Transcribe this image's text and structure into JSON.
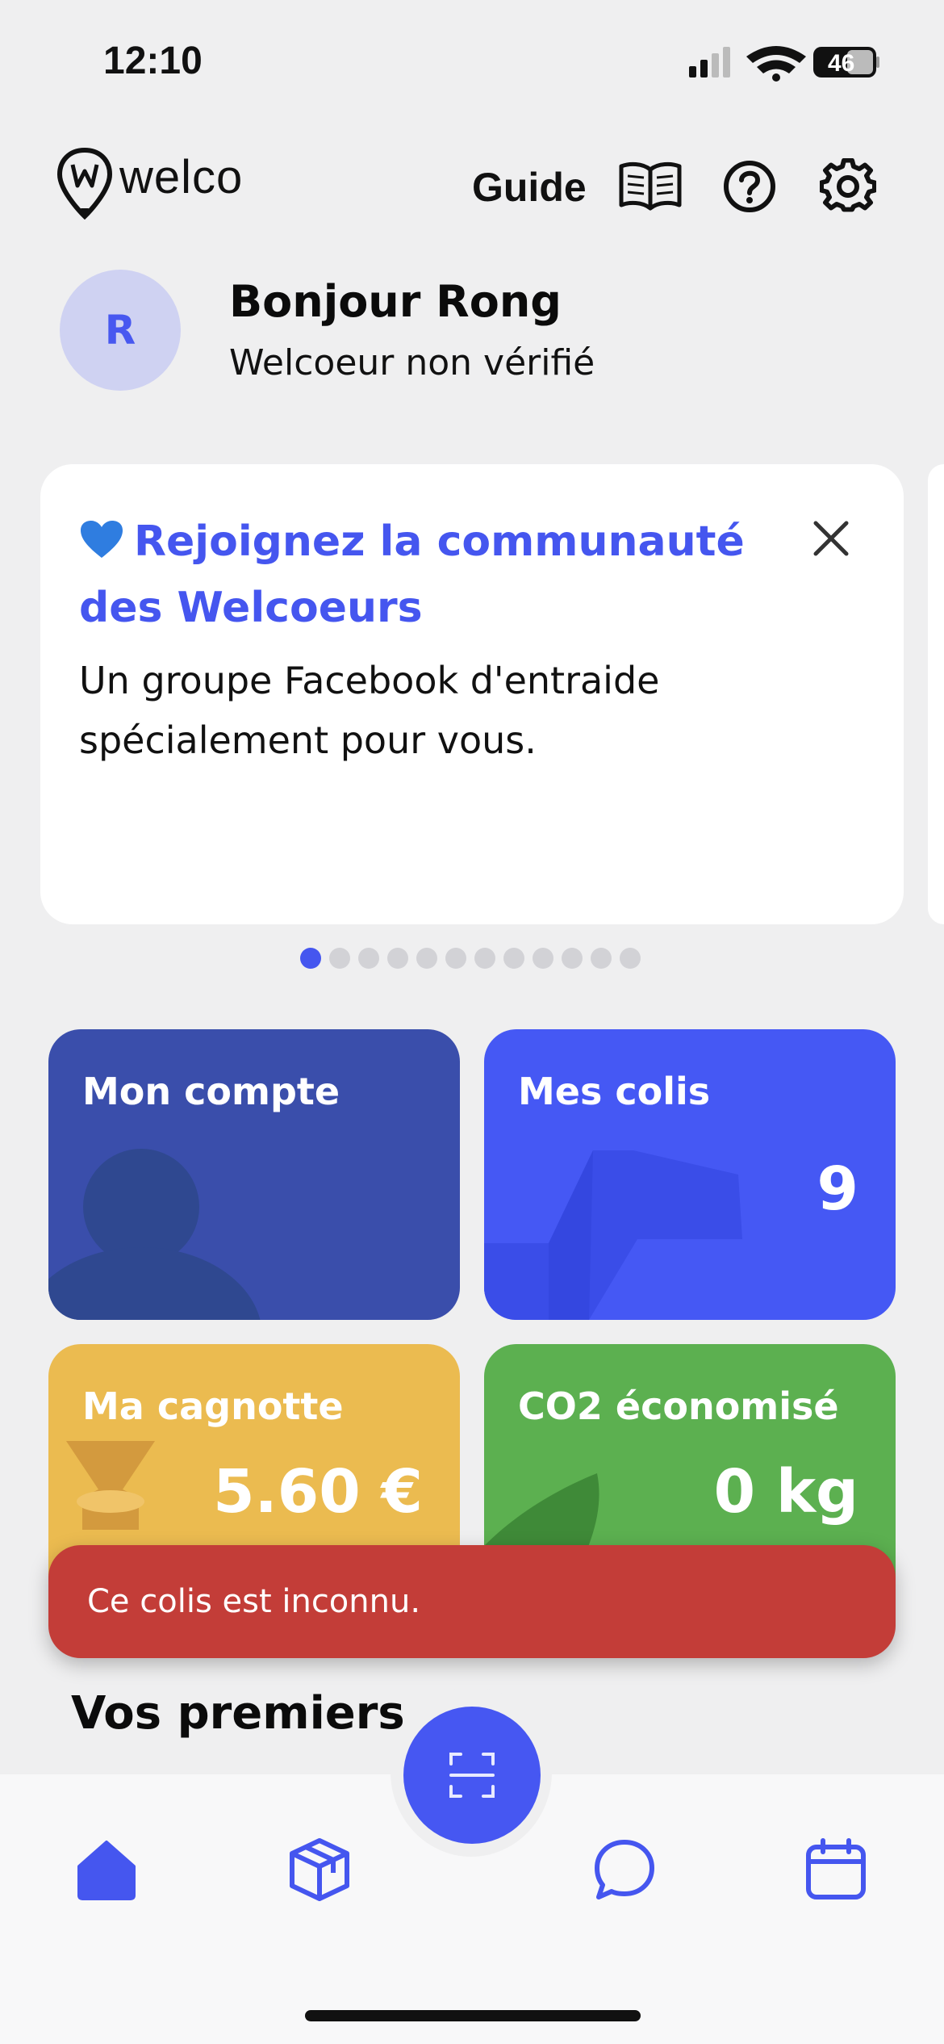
{
  "status_bar": {
    "time": "12:10",
    "battery": "46"
  },
  "header": {
    "logo_text": "welco",
    "guide_label": "Guide",
    "icons": [
      "book-icon",
      "help-icon",
      "gear-icon"
    ]
  },
  "profile": {
    "avatar_initial": "R",
    "greeting": "Bonjour Rong",
    "status": "Welcoeur non vérifié"
  },
  "promo": {
    "title": "Rejoignez la communauté des Welcoeurs",
    "description": "Un groupe Facebook d'entraide spécialement pour vous.",
    "page_count": 12,
    "active_page": 0
  },
  "tiles": {
    "account": {
      "title": "Mon compte"
    },
    "parcels": {
      "title": "Mes colis",
      "value": "9"
    },
    "wallet": {
      "title": "Ma cagnotte",
      "value": "5.60 €"
    },
    "co2": {
      "title": "CO2 économisé",
      "value": "0 kg"
    }
  },
  "toast": {
    "message": "Ce colis est inconnu."
  },
  "section": {
    "heading": "Vos premiers pas"
  },
  "colors": {
    "accent": "#4556ef",
    "account": "#3a4eab",
    "parcels": "#4558f4",
    "wallet": "#ebbb50",
    "co2": "#5cb050",
    "error": "#c33d38"
  },
  "tabbar": {
    "tabs": [
      "home-icon",
      "box-icon",
      "scan-icon",
      "chat-icon",
      "calendar-icon"
    ],
    "active": "home-icon"
  }
}
